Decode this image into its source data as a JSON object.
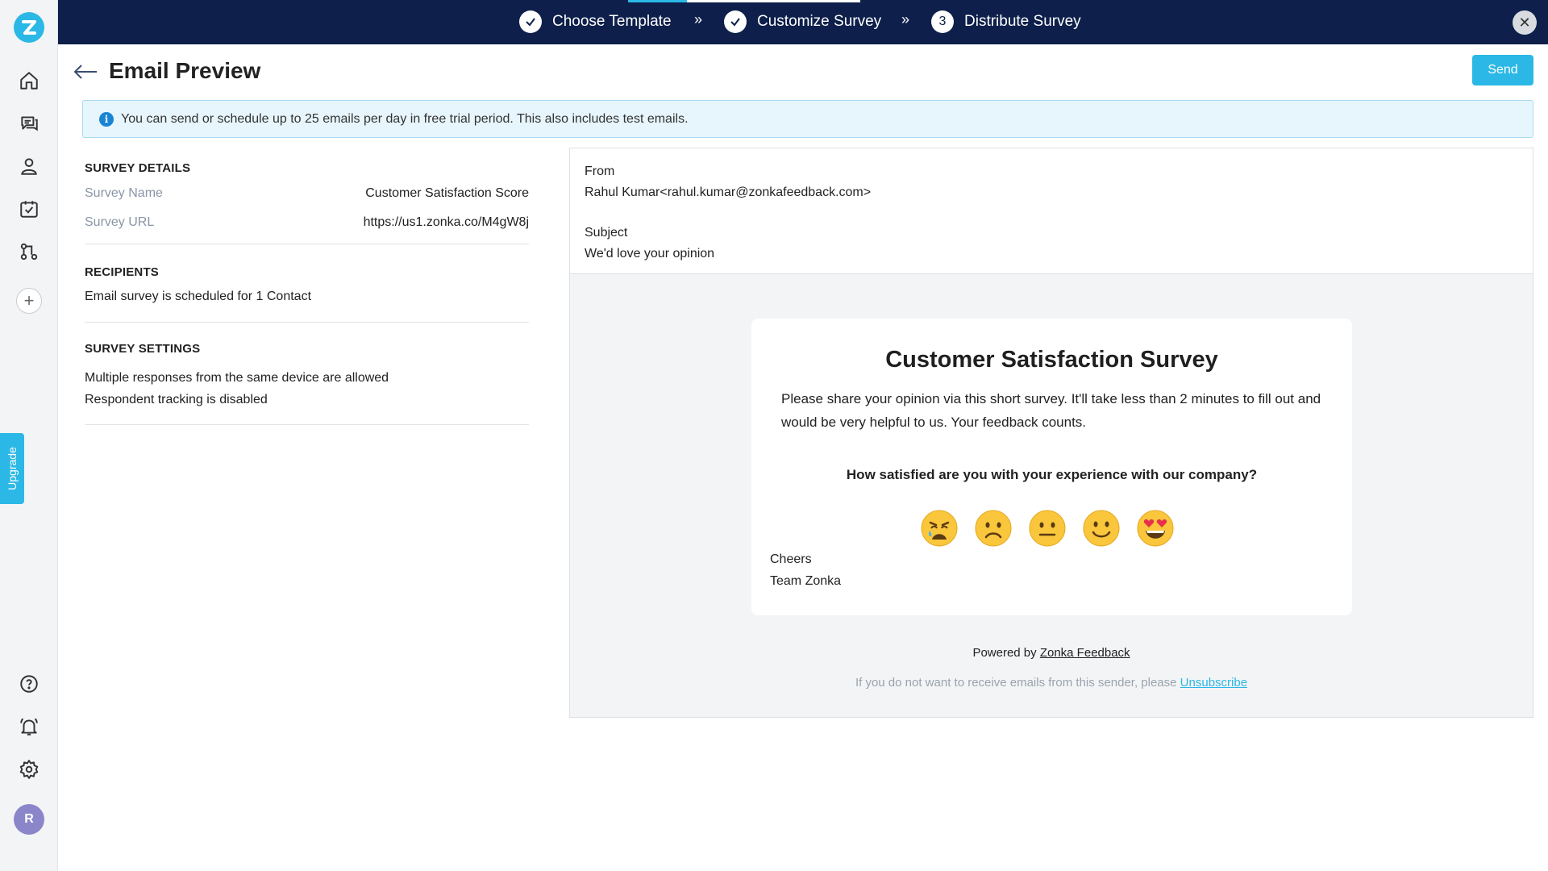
{
  "sidebar": {
    "logo_letter": "Z",
    "upgrade_label": "Upgrade",
    "avatar_initial": "R",
    "icons": [
      "home-icon",
      "chat-icon",
      "user-icon",
      "calendar-check-icon",
      "workflow-icon",
      "add-icon",
      "help-icon",
      "notification-bell-icon",
      "settings-gear-icon"
    ]
  },
  "topbar": {
    "steps": [
      {
        "label": "Choose Template",
        "state": "done"
      },
      {
        "label": "Customize Survey",
        "state": "done"
      },
      {
        "label": "Distribute Survey",
        "state": "current",
        "number": "3"
      }
    ],
    "separator": "»",
    "close_glyph": "✕"
  },
  "header": {
    "title": "Email Preview",
    "send_label": "Send"
  },
  "notice": {
    "icon": "i",
    "text": "You can send or schedule up to 25 emails per day in free trial period. This also includes test emails."
  },
  "details": {
    "survey_details_heading": "SURVEY DETAILS",
    "survey_name_label": "Survey Name",
    "survey_name_value": "Customer Satisfaction Score",
    "survey_url_label": "Survey URL",
    "survey_url_value": "https://us1.zonka.co/M4gW8j",
    "recipients_heading": "RECIPIENTS",
    "recipients_text": "Email survey is scheduled for 1 Contact",
    "settings_heading": "SURVEY SETTINGS",
    "settings_line1": "Multiple responses from the same device are allowed",
    "settings_line2": "Respondent tracking is disabled"
  },
  "email": {
    "from_label": "From",
    "from_value": "Rahul Kumar<rahul.kumar@zonkafeedback.com>",
    "subject_label": "Subject",
    "subject_value": "We'd love your opinion",
    "card_title": "Customer Satisfaction Survey",
    "card_intro": "Please share your opinion via this short survey. It'll take less than 2 minutes to fill out and would be very helpful to us. Your feedback counts.",
    "question": "How satisfied are you with your experience with our company?",
    "emoji_options": [
      "very-unsatisfied",
      "unsatisfied",
      "neutral",
      "satisfied",
      "very-satisfied"
    ],
    "cheers": "Cheers",
    "team": "Team Zonka",
    "powered_by": "Powered by",
    "powered_link": "Zonka Feedback",
    "unsub_text": "If you do not want to receive emails from this sender, please",
    "unsub_link": "Unsubscribe"
  },
  "colors": {
    "accent": "#2bb8e6",
    "topbar": "#0d1f4a",
    "notice_bg": "#e7f5fc"
  }
}
